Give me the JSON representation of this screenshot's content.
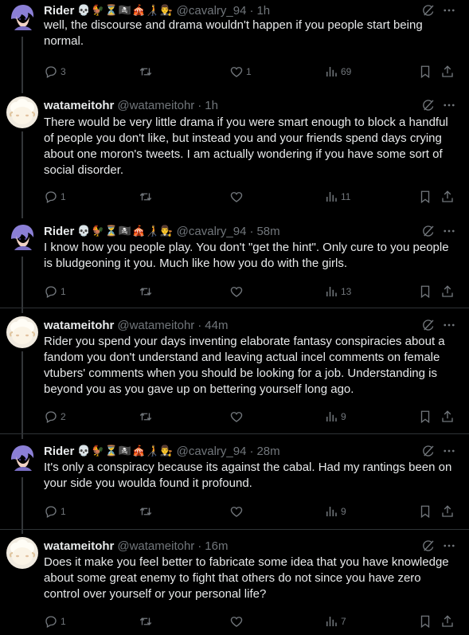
{
  "tweets": [
    {
      "name": "Rider",
      "emojis": "💀🐓⏳🏴‍☠️🎪🧑‍🦯👨‍⚖️",
      "handle": "@cavalry_94",
      "separator": "·",
      "time": "1h",
      "text": "well, the discourse and drama wouldn't happen if you people start being normal.",
      "replies": "3",
      "reposts": "",
      "likes": "1",
      "views": "69",
      "avatar": "purple-haired-character"
    },
    {
      "name": "watameitohr",
      "emojis": "",
      "handle": "@watameitohr",
      "separator": "·",
      "time": "1h",
      "text": "There would be very little drama if you were smart enough to block a handful of people you don't like, but instead you and your friends spend days crying about one moron's tweets. I am actually wondering if you have some sort of social disorder.",
      "replies": "1",
      "reposts": "",
      "likes": "",
      "views": "11",
      "avatar": "sheep-character"
    },
    {
      "name": "Rider",
      "emojis": "💀🐓⏳🏴‍☠️🎪🧑‍🦯👨‍⚖️",
      "handle": "@cavalry_94",
      "separator": "·",
      "time": "58m",
      "text": "I know how you people play. You don't \"get the hint\". Only cure to you people is bludgeoning it you. Much like how you do with the girls.",
      "replies": "1",
      "reposts": "",
      "likes": "",
      "views": "13",
      "avatar": "purple-haired-character"
    },
    {
      "name": "watameitohr",
      "emojis": "",
      "handle": "@watameitohr",
      "separator": "·",
      "time": "44m",
      "text": "Rider you spend your days inventing elaborate fantasy conspiracies about a fandom you don't understand and leaving actual incel comments on female vtubers' comments when you should be looking for a job. Understanding is beyond you as you gave up on bettering yourself long ago.",
      "replies": "2",
      "reposts": "",
      "likes": "",
      "views": "9",
      "avatar": "sheep-character"
    },
    {
      "name": "Rider",
      "emojis": "💀🐓⏳🏴‍☠️🎪🧑‍🦯👨‍⚖️",
      "handle": "@cavalry_94",
      "separator": "·",
      "time": "28m",
      "text": "It's only a conspiracy because its against the cabal. Had my rantings been on your side you woulda found it profound.",
      "replies": "1",
      "reposts": "",
      "likes": "",
      "views": "9",
      "avatar": "purple-haired-character"
    },
    {
      "name": "watameitohr",
      "emojis": "",
      "handle": "@watameitohr",
      "separator": "·",
      "time": "16m",
      "text": "Does it make you feel better to fabricate some idea that you have knowledge about some great enemy to fight that others do not since you have zero control over yourself or your personal life?",
      "replies": "1",
      "reposts": "",
      "likes": "",
      "views": "7",
      "avatar": "sheep-character"
    }
  ],
  "colors": {
    "background": "#000000",
    "text": "#e7e9ea",
    "muted": "#71767b",
    "divider": "#2f3336"
  }
}
